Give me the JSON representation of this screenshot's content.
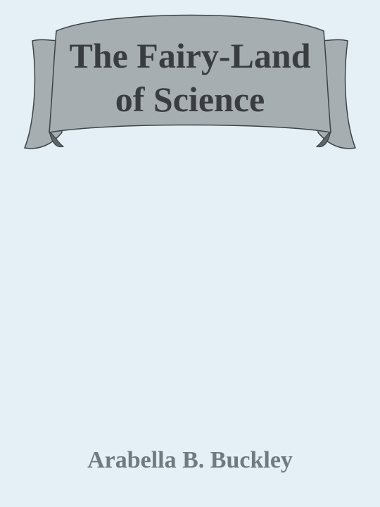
{
  "book": {
    "title_line_1": "The Fairy-Land",
    "title_line_2": "of Science",
    "author": "Arabella B. Buckley"
  },
  "colors": {
    "background": "#e4f0f5",
    "banner_fill": "#a7aeb1",
    "banner_shadow": "#5e666a",
    "banner_outline": "#3d4447",
    "title_text": "#3a3d40",
    "author_text": "#707a80"
  },
  "icons": {
    "banner": "ribbon-banner-icon"
  }
}
